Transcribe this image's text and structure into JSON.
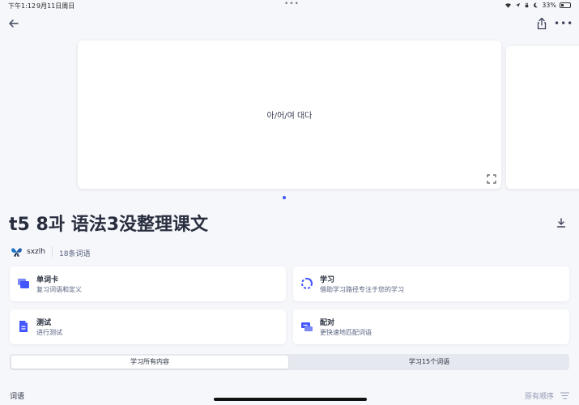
{
  "status_bar": {
    "time": "下午1:12",
    "date": "9月11日周日",
    "dots": "•••",
    "battery": "33%"
  },
  "toolbar": {
    "more_label": "•••"
  },
  "flashcard": {
    "term": "아/어/여 대다"
  },
  "set": {
    "title": "t5 8과 语法3没整理课文",
    "author": "sxzlh",
    "term_count": "18条词语"
  },
  "modes": [
    {
      "title": "单词卡",
      "subtitle": "复习词语和定义",
      "icon": "flashcards-icon"
    },
    {
      "title": "学习",
      "subtitle": "借助学习路径专注于您的学习",
      "icon": "learn-icon"
    },
    {
      "title": "测试",
      "subtitle": "进行测试",
      "icon": "test-icon"
    },
    {
      "title": "配对",
      "subtitle": "更快速地匹配词语",
      "icon": "match-icon"
    }
  ],
  "study_options": {
    "all": "学习所有内容",
    "subset": "学习15个词语"
  },
  "terms_section": {
    "label": "词语",
    "sort": "原有顺序"
  },
  "colors": {
    "accent": "#4255ff",
    "background": "#f6f7fb"
  }
}
